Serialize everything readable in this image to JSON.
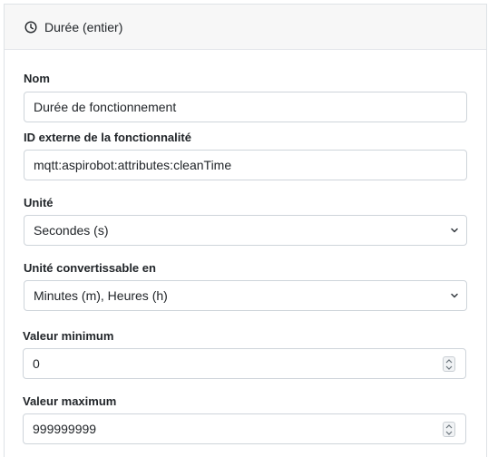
{
  "header": {
    "title": "Durée (entier)",
    "icon": "clock-icon"
  },
  "fields": {
    "name": {
      "label": "Nom",
      "value": "Durée de fonctionnement"
    },
    "external_id": {
      "label": "ID externe de la fonctionnalité",
      "value": "mqtt:aspirobot:attributes:cleanTime"
    },
    "unit": {
      "label": "Unité",
      "value": "Secondes (s)"
    },
    "convertible_unit": {
      "label": "Unité convertissable en",
      "value": "Minutes (m), Heures (h)"
    },
    "min_value": {
      "label": "Valeur minimum",
      "value": "0"
    },
    "max_value": {
      "label": "Valeur maximum",
      "value": "999999999"
    }
  },
  "colors": {
    "header_bg": "#f7f7f7",
    "border": "#ced4da",
    "text": "#212529"
  }
}
